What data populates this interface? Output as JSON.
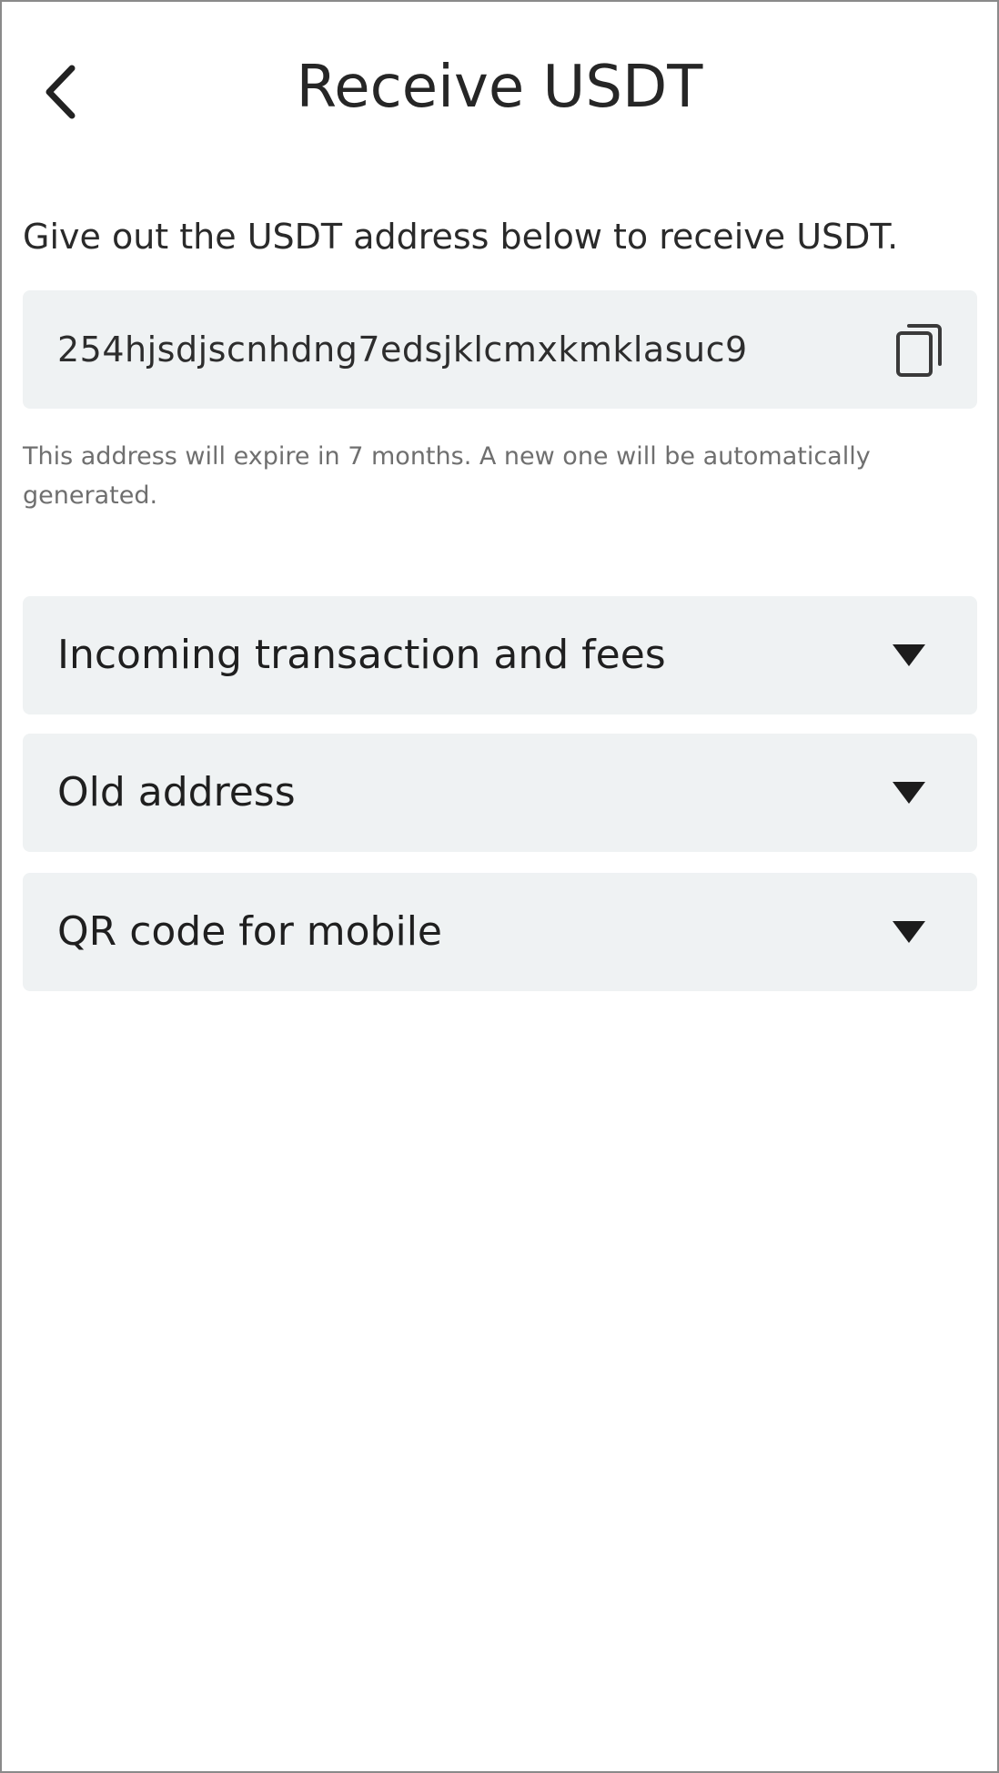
{
  "header": {
    "title": "Receive USDT",
    "back_icon": "chevron-left-icon"
  },
  "intro": {
    "text": "Give out the USDT address below to receive USDT."
  },
  "address": {
    "value": "254hjsdjscnhdng7edsjklcmxkmklasuc9",
    "copy_icon": "copy-icon"
  },
  "note": {
    "text": "This address will expire in 7 months. A new one will be automatically generated."
  },
  "sections": [
    {
      "label": "Incoming transaction and fees",
      "icon": "caret-down-icon"
    },
    {
      "label": "Old address",
      "icon": "caret-down-icon"
    },
    {
      "label": "QR code for mobile",
      "icon": "caret-down-icon"
    }
  ],
  "colors": {
    "panel_background": "#eff2f3",
    "text_primary": "#1f1f1f",
    "text_muted": "#6f6f6f",
    "border": "#8a8a8a"
  }
}
